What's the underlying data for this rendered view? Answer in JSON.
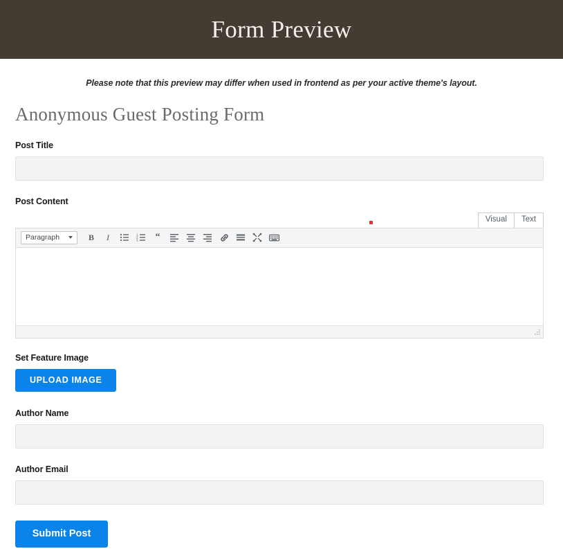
{
  "header": {
    "title": "Form Preview",
    "bg_color": "#443b32",
    "text_color": "#f3efe9"
  },
  "notice": {
    "text": "Please note that this preview may differ when used in frontend as per your active theme's layout."
  },
  "form": {
    "heading": "Anonymous Guest Posting Form",
    "accent_color": "#0a84e8",
    "fields": {
      "post_title": {
        "label": "Post Title",
        "value": "",
        "placeholder": ""
      },
      "post_content": {
        "label": "Post Content",
        "value": "",
        "placeholder": ""
      },
      "feature_image": {
        "label": "Set Feature Image",
        "button_label": "UPLOAD IMAGE"
      },
      "author_name": {
        "label": "Author Name",
        "value": "",
        "placeholder": ""
      },
      "author_email": {
        "label": "Author Email",
        "value": "",
        "placeholder": ""
      }
    },
    "submit_label": "Submit Post"
  },
  "editor": {
    "tabs": [
      {
        "label": "Visual",
        "active": true
      },
      {
        "label": "Text",
        "active": false
      }
    ],
    "format_select": {
      "value": "Paragraph",
      "icon": "chevron-down-icon"
    },
    "toolbar_buttons": [
      {
        "name": "bold-icon",
        "label": "B"
      },
      {
        "name": "italic-icon",
        "label": "I"
      },
      {
        "name": "bulleted-list-icon",
        "label": "Bulleted list"
      },
      {
        "name": "numbered-list-icon",
        "label": "Numbered list"
      },
      {
        "name": "blockquote-icon",
        "label": "Blockquote"
      },
      {
        "name": "align-left-icon",
        "label": "Align left"
      },
      {
        "name": "align-center-icon",
        "label": "Align center"
      },
      {
        "name": "align-right-icon",
        "label": "Align right"
      },
      {
        "name": "link-icon",
        "label": "Insert/edit link"
      },
      {
        "name": "read-more-icon",
        "label": "Insert Read More tag"
      },
      {
        "name": "fullscreen-icon",
        "label": "Distraction-free writing mode"
      },
      {
        "name": "keyboard-shortcuts-icon",
        "label": "Keyboard shortcuts"
      }
    ],
    "status_bar": {
      "resize_handle": "resize-grip-icon"
    },
    "marker": {
      "name": "red-dot-marker",
      "color": "#d63638"
    }
  }
}
